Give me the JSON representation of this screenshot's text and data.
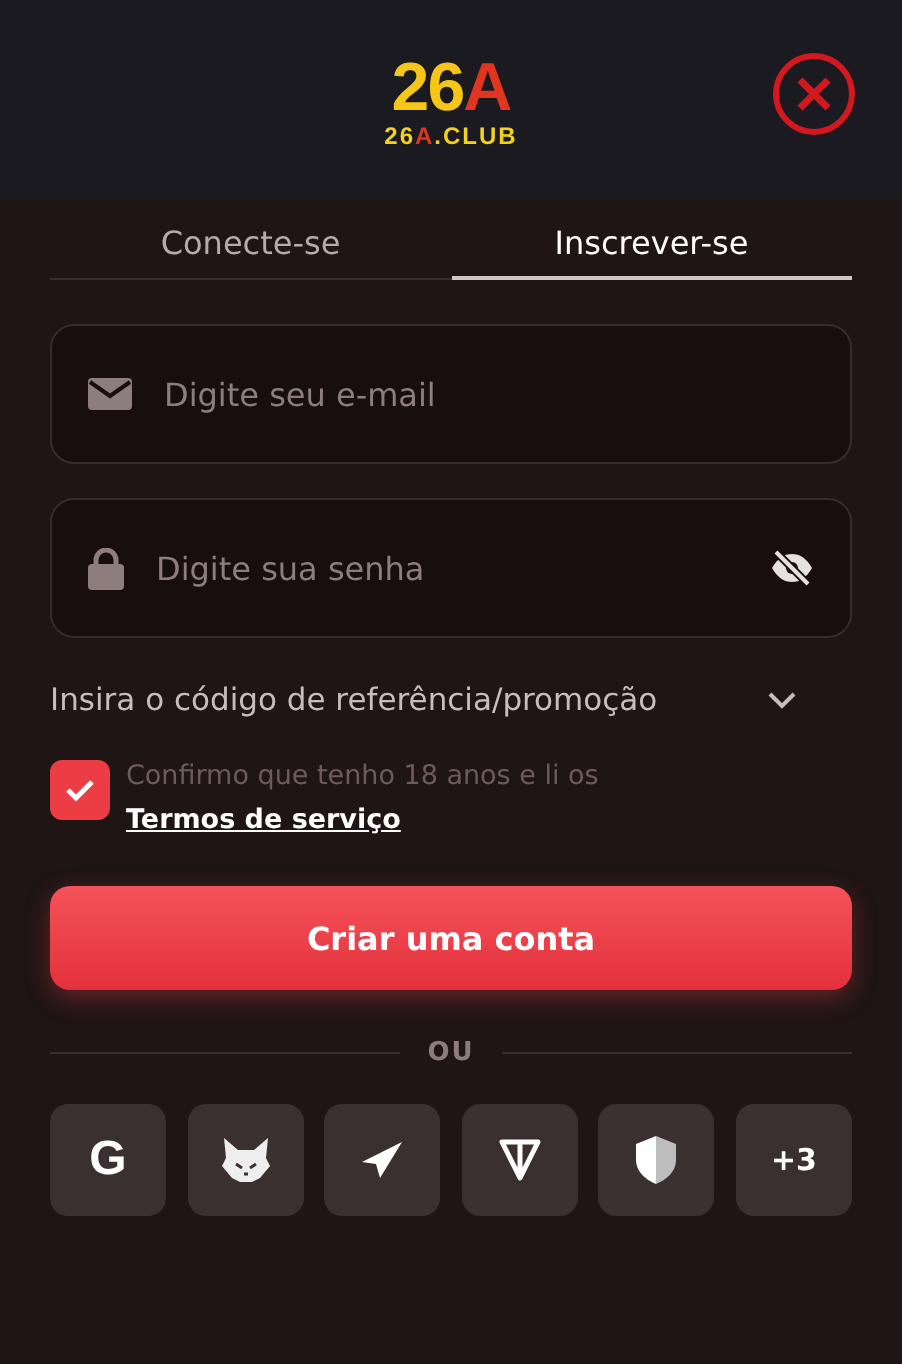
{
  "logo": {
    "title": [
      {
        "text": "26",
        "accent": false
      },
      {
        "text": "A",
        "accent": true
      }
    ],
    "subtitle": [
      {
        "text": "26",
        "accent": false
      },
      {
        "text": "A",
        "accent": true
      },
      {
        "text": ".CLUB",
        "accent": false
      }
    ]
  },
  "tabs": [
    {
      "label": "Conecte-se",
      "selected": false
    },
    {
      "label": "Inscrever-se",
      "selected": true
    }
  ],
  "fields": [
    {
      "kind": "email",
      "placeholder": "Digite seu e-mail"
    },
    {
      "kind": "password",
      "placeholder": "Digite sua senha"
    }
  ],
  "promo": {
    "label": "Insira o código de referência/promoção",
    "expanded": false
  },
  "terms": {
    "checked": true,
    "text": "Confirmo que tenho 18 anos e li os ",
    "link": "Termos de serviço"
  },
  "submit": "Criar uma conta",
  "divider": "OU",
  "socials": [
    {
      "kind": "google",
      "label": "G"
    },
    {
      "kind": "fox"
    },
    {
      "kind": "telegram"
    },
    {
      "kind": "ton"
    },
    {
      "kind": "shield"
    },
    {
      "kind": "more",
      "label": "+3"
    }
  ]
}
